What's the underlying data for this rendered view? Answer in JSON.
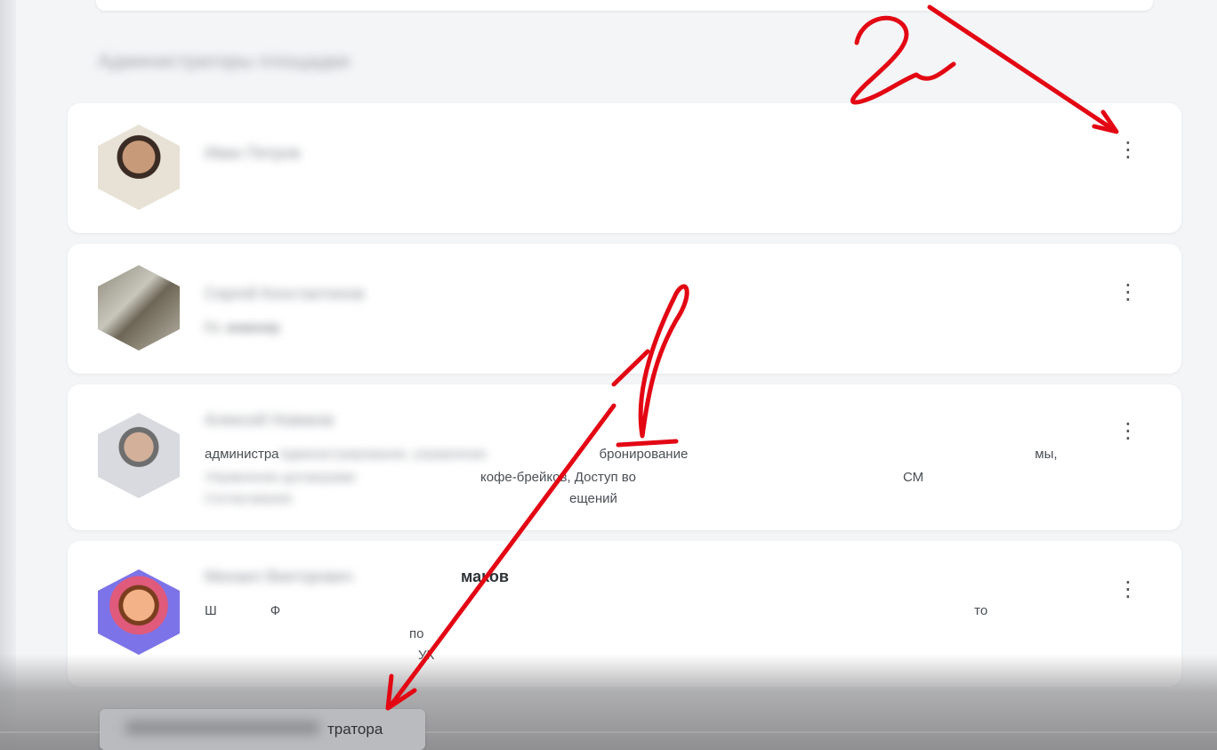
{
  "section_title": "Администраторы площадки",
  "cards": [
    {
      "name": "Иван Петров",
      "subtitle": "",
      "lines": []
    },
    {
      "name": "Сергей Константинов",
      "subtitle": "Гл. инженер",
      "lines": []
    },
    {
      "name": "Алексей Новиков",
      "lines": [
        {
          "blurred": "Администрирование, управление",
          "visible": "администра",
          "visible_mid": "бронирование",
          "visible_end": "мы,"
        },
        {
          "blurred": "Управление договорами",
          "visible": "кофе-брейков, Доступ во",
          "visible_end": "СМ"
        },
        {
          "blurred": "Согласование",
          "visible": "ещений"
        }
      ]
    },
    {
      "name_blurred": "Михаил Викторович",
      "name_visible": "маков",
      "lines": [
        {
          "visible": "Ш",
          "visible_2": "Ф",
          "visible_end": "то"
        },
        {
          "visible": "по"
        },
        {
          "visible": "УК"
        }
      ]
    }
  ],
  "admin_button": {
    "label_blurred": "Назначить администратора",
    "label_visible": "тратора"
  },
  "annotations": {
    "number_1": "1",
    "number_2": "2",
    "color": "#e30613"
  },
  "icons": {
    "card_menu": "more-vertical-icon"
  }
}
